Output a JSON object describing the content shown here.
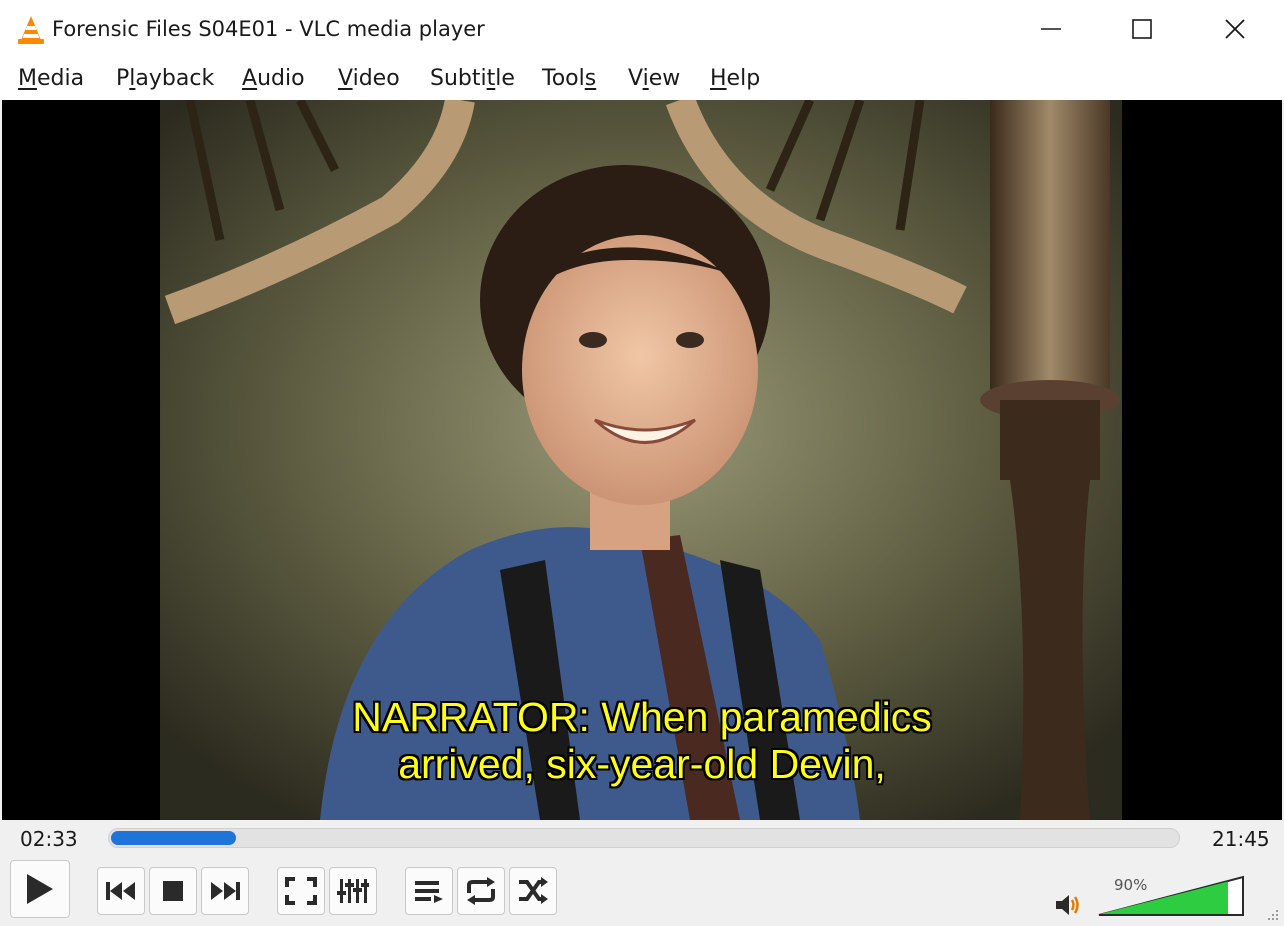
{
  "window": {
    "title": "Forensic Files S04E01 - VLC media player",
    "app_icon": "vlc-cone-icon",
    "controls": [
      "minimize-icon",
      "maximize-icon",
      "close-icon"
    ]
  },
  "menu": {
    "items": [
      {
        "pre": "",
        "u": "M",
        "post": "edia"
      },
      {
        "pre": "P",
        "u": "l",
        "post": "ayback"
      },
      {
        "pre": "",
        "u": "A",
        "post": "udio"
      },
      {
        "pre": "",
        "u": "V",
        "post": "ideo"
      },
      {
        "pre": "Subti",
        "u": "t",
        "post": "le"
      },
      {
        "pre": "Tool",
        "u": "s",
        "post": ""
      },
      {
        "pre": "V",
        "u": "i",
        "post": "ew"
      },
      {
        "pre": "",
        "u": "H",
        "post": "elp"
      }
    ]
  },
  "video": {
    "subtitle_line1": "NARRATOR: When paramedics",
    "subtitle_line2": "arrived, six-year-old Devin,",
    "subtitle_color": "#ffff1a"
  },
  "player": {
    "elapsed": "02:33",
    "duration": "21:45",
    "progress_fraction": 0.117,
    "seek_color": "#1e74d8",
    "volume_label": "90%",
    "volume_fraction": 0.9,
    "volume_color": "#2ecc40",
    "buttons": [
      "play-icon",
      "previous-icon",
      "stop-icon",
      "next-icon",
      "fullscreen-icon",
      "extended-settings-icon",
      "playlist-icon",
      "loop-icon",
      "shuffle-icon"
    ]
  }
}
